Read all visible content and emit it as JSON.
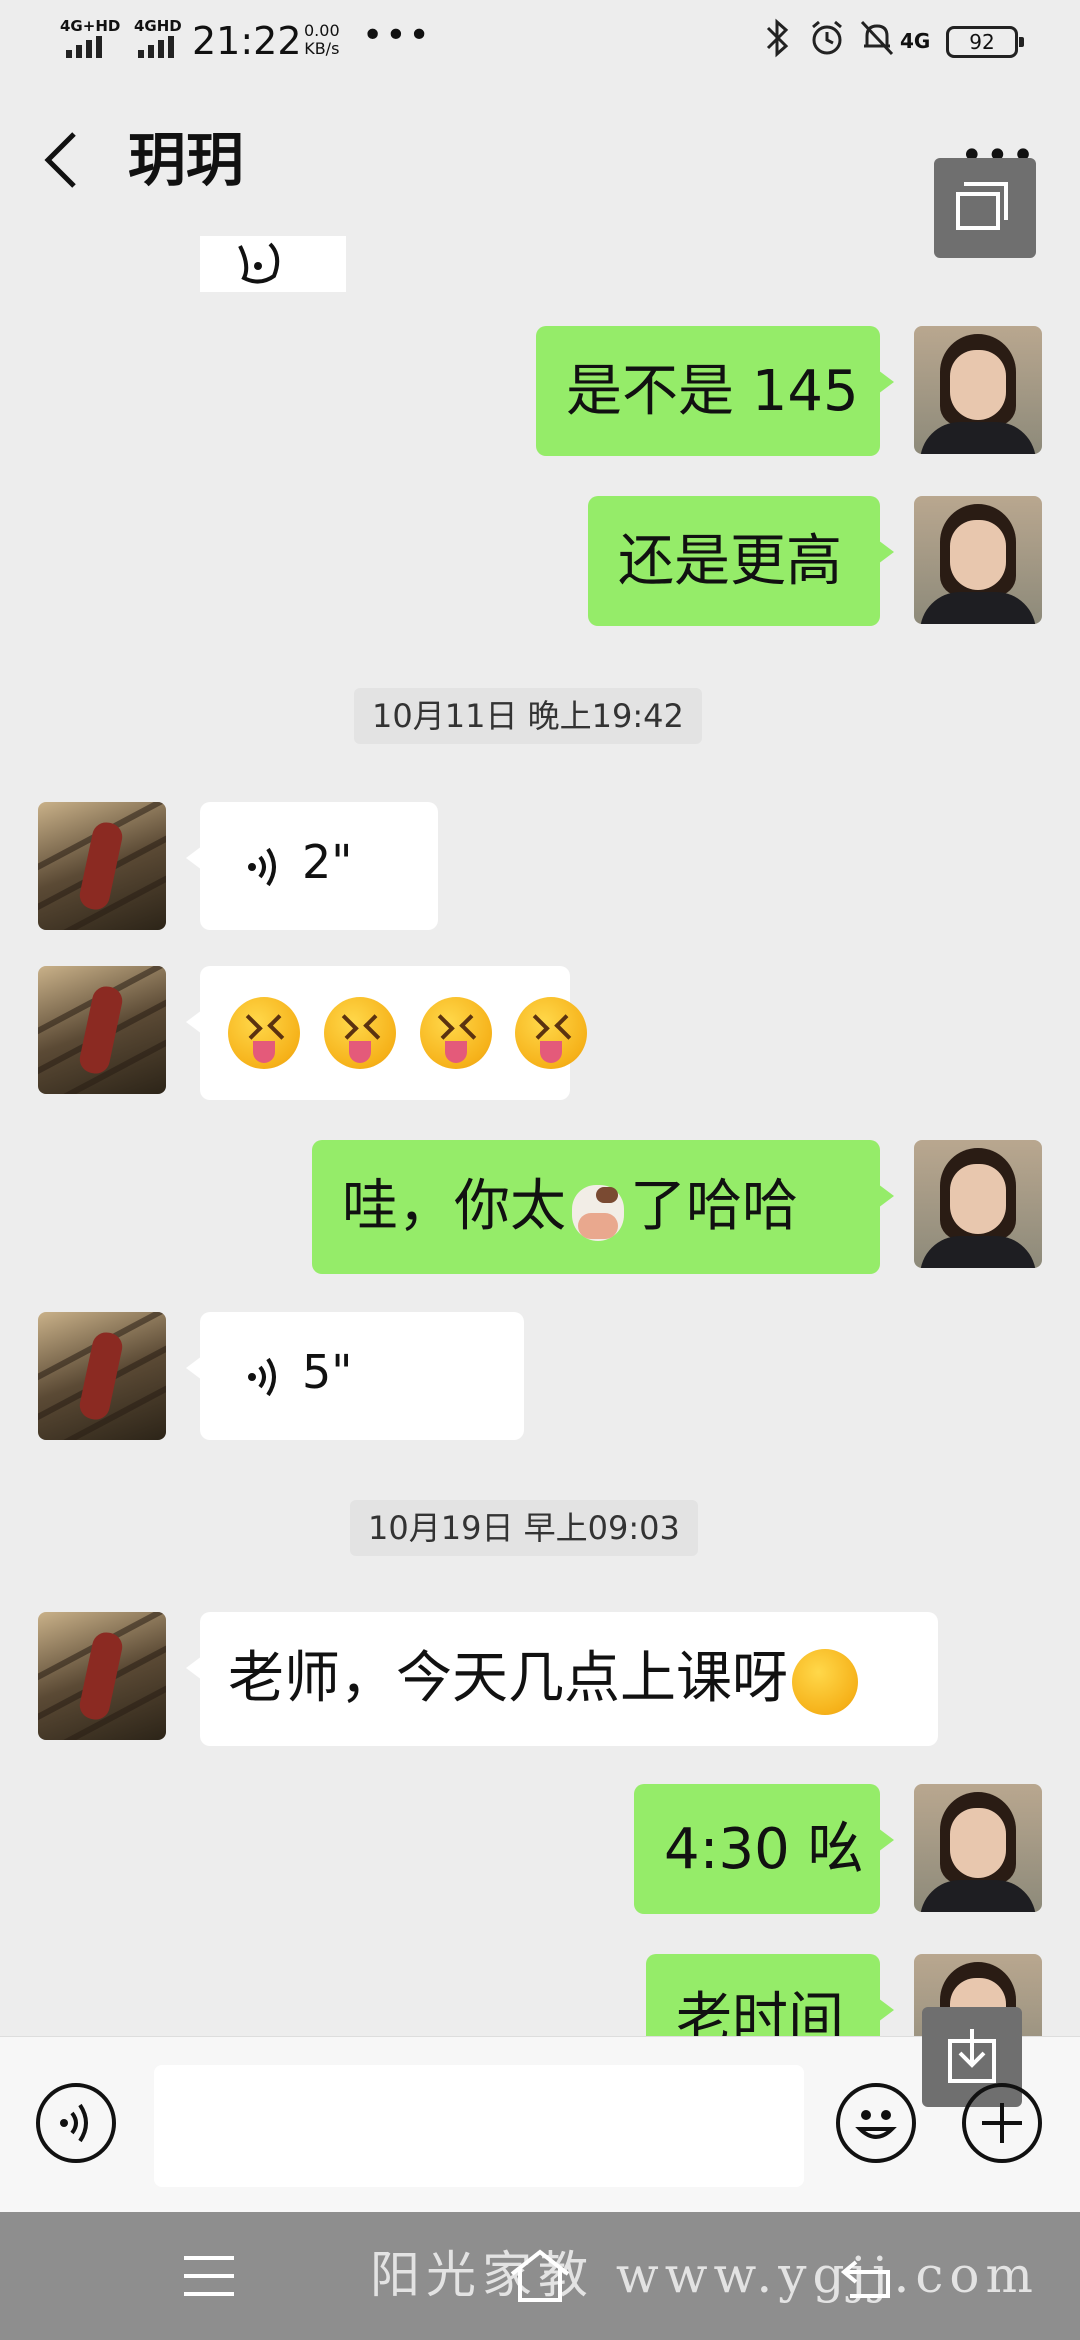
{
  "status_bar": {
    "signal1": "4G+HD",
    "signal2": "4GHD",
    "time": "21:22",
    "speed_value": "0.00",
    "speed_unit": "KB/s",
    "dots": "•••",
    "network": "4G",
    "battery": "92"
  },
  "header": {
    "title": "玥玥",
    "more": "•••"
  },
  "messages": [
    {
      "side": "me",
      "text": "是不是 145"
    },
    {
      "side": "me",
      "text": "还是更高"
    },
    {
      "type": "time",
      "text": "10月11日 晚上19:42"
    },
    {
      "side": "other",
      "type": "voice",
      "duration": "2\""
    },
    {
      "side": "other",
      "type": "emoji",
      "emoji": "squinting-face-with-tongue",
      "count": 4
    },
    {
      "side": "me",
      "text_before": "哇，你太",
      "emoji": "cow-face",
      "text_after": "了哈哈"
    },
    {
      "side": "other",
      "type": "voice",
      "duration": "5\""
    },
    {
      "type": "time",
      "text": "10月19日 早上09:03"
    },
    {
      "side": "other",
      "text": "老师，今天几点上课呀",
      "emoji": "winking-face-with-tongue"
    },
    {
      "side": "me",
      "text": "4:30 吆"
    },
    {
      "side": "me",
      "text": "老时间"
    }
  ],
  "watermark": "阳光家教 www.ygjj.com",
  "colors": {
    "background": "#ededed",
    "my_bubble": "#95ec69",
    "other_bubble": "#ffffff",
    "nav_bar": "#8e8e8e"
  }
}
